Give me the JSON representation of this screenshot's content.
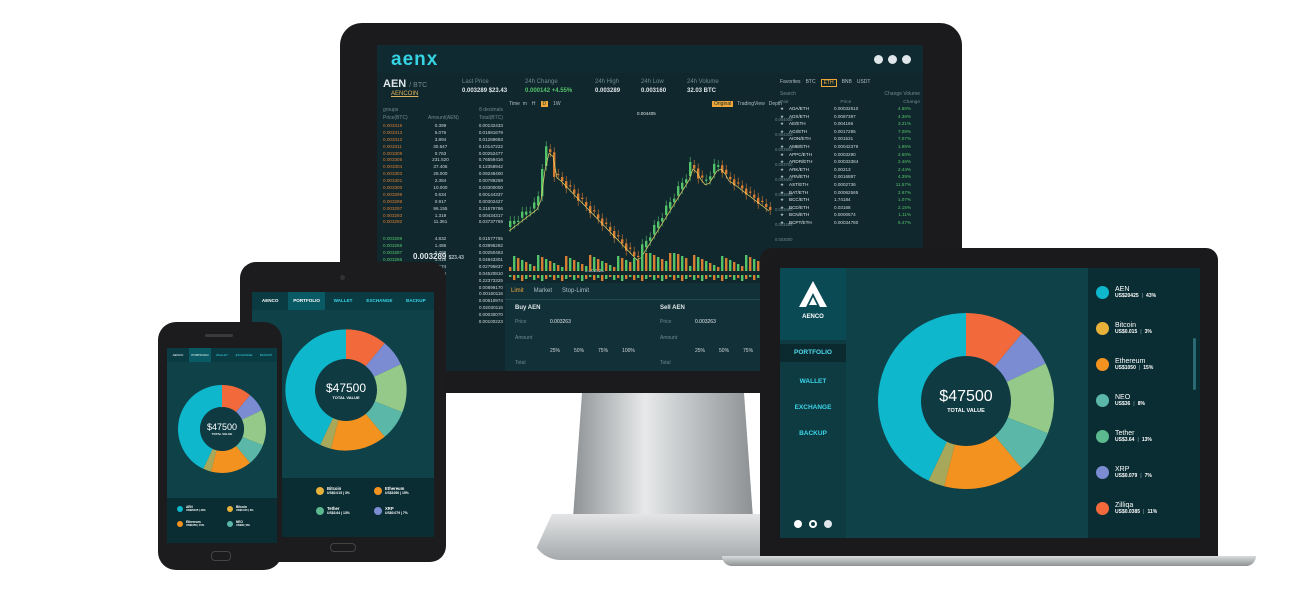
{
  "colors": {
    "teal": "#0fb7cc",
    "orange": "#f2693b",
    "purple": "#7b8cd2",
    "lightgreen": "#94c98a",
    "seagreen": "#5bb8a8",
    "amber": "#f4921f",
    "olive": "#a8a85a",
    "bg": "#0f4149"
  },
  "desktop": {
    "logo": "aenx",
    "pair": "AEN",
    "pair_quote": "/ BTC",
    "pair_sub": "AENCOIN",
    "stats": [
      {
        "label": "Last Price",
        "value": "0.003289 $23.43",
        "green": false
      },
      {
        "label": "24h Change",
        "value": "0.000142 +4.55%",
        "green": true
      },
      {
        "label": "24h High",
        "value": "0.003289",
        "green": false
      },
      {
        "label": "24h Low",
        "value": "0.003160",
        "green": false
      },
      {
        "label": "24h Volume",
        "value": "32.03 BTC",
        "green": false
      }
    ],
    "orderbook": {
      "groups_label": "groups",
      "groups_value": "8 decimals",
      "headers": [
        "Price(BTC)",
        "Amount(AEN)",
        "Total(BTC)"
      ],
      "asks": [
        [
          "0.003315",
          "0.399",
          "0.00132433"
        ],
        [
          "0.003313",
          "5.076",
          "0.01681679"
        ],
        [
          "0.003312",
          "3.894",
          "0.01289693"
        ],
        [
          "0.003311",
          "30.647",
          "0.10147222"
        ],
        [
          "0.003309",
          "0.763",
          "0.00252477"
        ],
        [
          "0.003305",
          "231.520",
          "0.76559416"
        ],
        [
          "0.003304",
          "37.406",
          "0.12358942"
        ],
        [
          "0.003303",
          "28.000",
          "0.09248400"
        ],
        [
          "0.003301",
          "2.384",
          "0.00789259"
        ],
        [
          "0.003300",
          "10.000",
          "0.03300000"
        ],
        [
          "0.003299",
          "0.634",
          "0.00144337"
        ],
        [
          "0.003298",
          "0.917",
          "0.00302427"
        ],
        [
          "0.003297",
          "96.155",
          "0.31679786"
        ],
        [
          "0.003293",
          "1.319",
          "0.00434317"
        ],
        [
          "0.003292",
          "11.361",
          "0.03737769"
        ]
      ],
      "mid_price": "0.003289",
      "mid_usd": "$23.43",
      "bids": [
        [
          "0.003289",
          "4.832",
          "0.01577765"
        ],
        [
          "0.003288",
          "1.486",
          "0.03995282"
        ],
        [
          "0.003287",
          "0.769",
          "0.00250463"
        ],
        [
          "0.003286",
          "1.418",
          "0.04843301"
        ],
        [
          "0.003285",
          "0.574",
          "0.02795837"
        ],
        [
          "0.003284",
          "3.276",
          "0.04520810"
        ],
        [
          "0.003283",
          "6.841",
          "0.22373325"
        ],
        [
          "0.003282",
          "2.673",
          "0.00899170"
        ],
        [
          "0.003281",
          "1.309",
          "0.00160116"
        ],
        [
          "0.003280",
          "3.301",
          "0.00610974"
        ],
        [
          "0.003279",
          "6.177",
          "0.02030115"
        ],
        [
          "0.003278",
          "9.327",
          "0.00030070"
        ],
        [
          "0.003277",
          "0.310",
          "0.00100223"
        ]
      ]
    },
    "chart_toolbar": {
      "time": "Time",
      "intervals": [
        "m",
        "H",
        "D",
        "1W"
      ],
      "active": "D"
    },
    "chart_views": [
      "Original",
      "TradingView",
      "Depth"
    ],
    "chart_marks": {
      "high": "0.004405",
      "low": "0.002526"
    },
    "price_scale": [
      "0.004000",
      "0.004200",
      "0.003900",
      "0.003700",
      "0.003600",
      "0.003500",
      "0.003400",
      "0.003289",
      "0.003000",
      "0.002600",
      "0.002521"
    ],
    "markets": {
      "tabs": [
        "Favorites",
        "BTC",
        "ETH",
        "BNB",
        "USDT"
      ],
      "active_tab": "ETH",
      "search_placeholder": "Search",
      "toggle": [
        "Change",
        "Volume"
      ],
      "headers": [
        "Pair",
        "Price",
        "Change"
      ],
      "rows": [
        [
          "ADA/ETH",
          "0.00032610",
          "4.60%"
        ],
        [
          "ADX/ETH",
          "0.0087397",
          "4.36%"
        ],
        [
          "AE/ETH",
          "0.004166",
          "3.21%"
        ],
        [
          "AGI/ETH",
          "0.0017295",
          "7.08%"
        ],
        [
          "AION/ETH",
          "0.001531",
          "7.07%"
        ],
        [
          "AMB/ETH",
          "0.00042379",
          "1.95%"
        ],
        [
          "APPC/ETH",
          "0.0003290",
          "2.50%"
        ],
        [
          "ARDR/ETH",
          "0.00033384",
          "2.46%"
        ],
        [
          "ARK/ETH",
          "0.00213",
          "2.44%"
        ],
        [
          "ARN/ETH",
          "0.0016887",
          "4.39%"
        ],
        [
          "AST/ETH",
          "0.0002736",
          "11.57%"
        ],
        [
          "BAT/ETH",
          "0.00062565",
          "2.97%"
        ],
        [
          "BCC/ETH",
          "1.74184",
          "1.07%"
        ],
        [
          "BCD/ETH",
          "0.03168",
          "2.15%"
        ],
        [
          "BCN/ETH",
          "0.0000574",
          "1.11%"
        ],
        [
          "BCPT/ETH",
          "0.00034780",
          "6.47%"
        ]
      ]
    },
    "trade": {
      "tabs": [
        "Limit",
        "Market",
        "Stop-Limit"
      ],
      "buy_title": "Buy AEN",
      "sell_title": "Sell AEN",
      "btc": "BTC",
      "price_label": "Price",
      "amount_label": "Amount",
      "total_label": "Total",
      "buy_price": "0.003263",
      "sell_price": "0.003263",
      "percents": [
        "25%",
        "50%",
        "75%",
        "100%"
      ]
    }
  },
  "portfolio": {
    "brand": "AENCO",
    "nav": [
      "PORTFOLIO",
      "WALLET",
      "EXCHANGE",
      "BACKUP"
    ],
    "total": "$47500",
    "total_label": "TOTAL VALUE",
    "slices": [
      {
        "name": "AEN",
        "value": 43,
        "color": "#0fb7cc"
      },
      {
        "name": "Zilliqa",
        "value": 11,
        "color": "#f2693b"
      },
      {
        "name": "XRP",
        "value": 7,
        "color": "#7b8cd2"
      },
      {
        "name": "Tether",
        "value": 13,
        "color": "#94c98a"
      },
      {
        "name": "NEO",
        "value": 8,
        "color": "#5bb8a8"
      },
      {
        "name": "Ethereum",
        "value": 15,
        "color": "#f4921f"
      },
      {
        "name": "Bitcoin",
        "value": 3,
        "color": "#a8a85a"
      }
    ],
    "coins": [
      {
        "name": "AEN",
        "value": "US$20425",
        "pct": "43%",
        "color": "#0fb7cc"
      },
      {
        "name": "Bitcoin",
        "value": "US$0.015",
        "pct": "3%",
        "color": "#e8b13a"
      },
      {
        "name": "Ethereum",
        "value": "US$1050",
        "pct": "15%",
        "color": "#f4921f"
      },
      {
        "name": "NEO",
        "value": "US$36",
        "pct": "8%",
        "color": "#5bb8a8"
      },
      {
        "name": "Tether",
        "value": "US$3.64",
        "pct": "13%",
        "color": "#5bb88f"
      },
      {
        "name": "XRP",
        "value": "US$0.079",
        "pct": "7%",
        "color": "#7b8cd2"
      },
      {
        "name": "Zilliqa",
        "value": "US$0.0385",
        "pct": "11%",
        "color": "#f2693b"
      }
    ],
    "tablet_coins": [
      {
        "name": "Bitcoin",
        "value": "US$0.015",
        "pct": "3%",
        "color": "#e8b13a"
      },
      {
        "name": "Ethereum",
        "value": "US$1050",
        "pct": "15%",
        "color": "#f4921f"
      },
      {
        "name": "Tether",
        "value": "US$3.64",
        "pct": "13%",
        "color": "#5bb88f"
      },
      {
        "name": "XRP",
        "value": "US$0.079",
        "pct": "7%",
        "color": "#7b8cd2"
      }
    ],
    "phone_coins": [
      {
        "name": "AEN",
        "value": "US$20425",
        "pct": "43%",
        "color": "#0fb7cc"
      },
      {
        "name": "Bitcoin",
        "value": "US$0.015",
        "pct": "3%",
        "color": "#e8b13a"
      },
      {
        "name": "Ethereum",
        "value": "US$1050",
        "pct": "15%",
        "color": "#f4921f"
      },
      {
        "name": "NEO",
        "value": "US$36",
        "pct": "8%",
        "color": "#5bb8a8"
      }
    ]
  }
}
